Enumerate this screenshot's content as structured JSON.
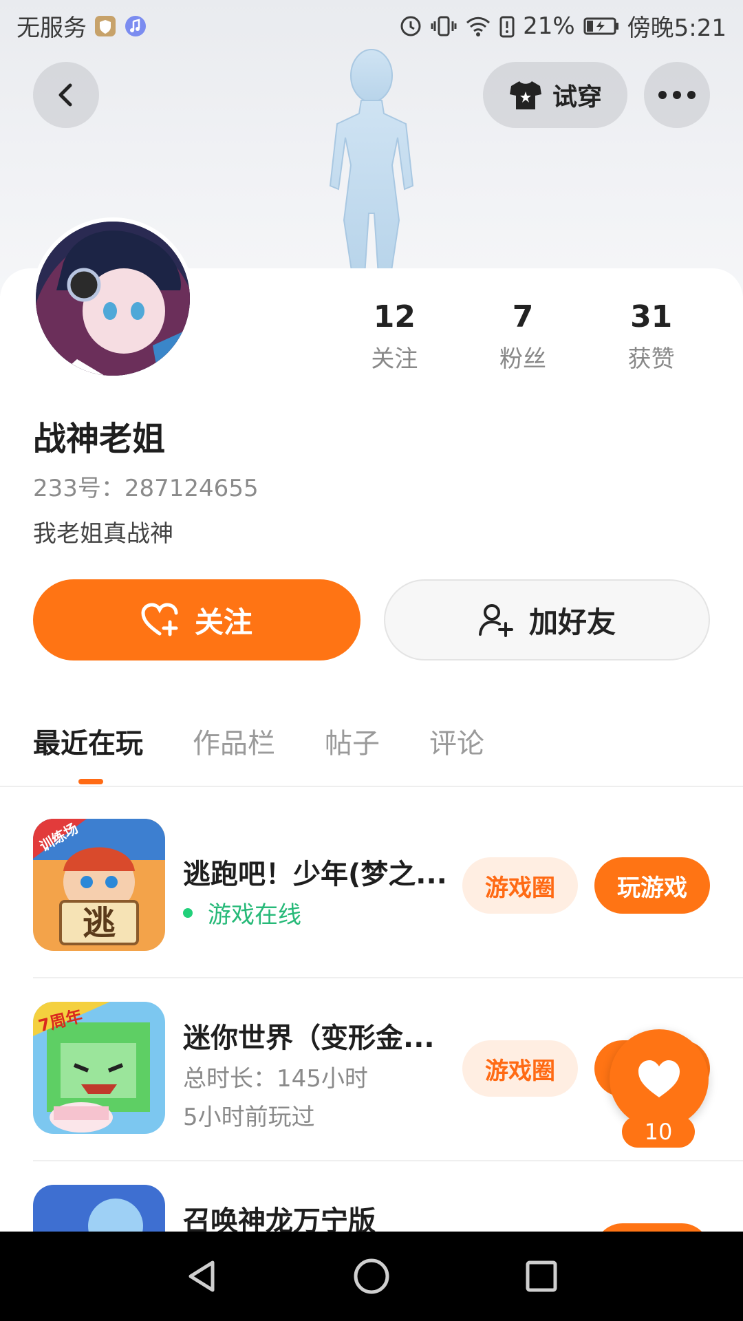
{
  "status_bar": {
    "carrier": "无服务",
    "battery": "21%",
    "time": "傍晚5:21"
  },
  "header": {
    "tryon_label": "试穿"
  },
  "profile": {
    "name": "战神老姐",
    "uid": "233号：287124655",
    "bio": "我老姐真战神",
    "stats": [
      {
        "value": "12",
        "label": "关注"
      },
      {
        "value": "7",
        "label": "粉丝"
      },
      {
        "value": "31",
        "label": "获赞"
      }
    ],
    "follow_label": "关注",
    "add_friend_label": "加好友"
  },
  "tabs": [
    "最近在玩",
    "作品栏",
    "帖子",
    "评论"
  ],
  "games": [
    {
      "title": "逃跑吧！少年(梦之...",
      "status": "游戏在线",
      "badge": "训练场",
      "thumb_char": "逃",
      "circle_label": "游戏圈",
      "play_label": "玩游戏"
    },
    {
      "title": "迷你世界（变形金...",
      "total_time": "总时长：145小时",
      "last_played": "5小时前玩过",
      "badge": "7周年",
      "circle_label": "游戏圈",
      "play_label": "玩游戏"
    },
    {
      "title": "召唤神龙万宁版"
    }
  ],
  "like_fab": {
    "count": "10"
  },
  "colors": {
    "accent": "#ff7414",
    "online": "#26b978"
  }
}
